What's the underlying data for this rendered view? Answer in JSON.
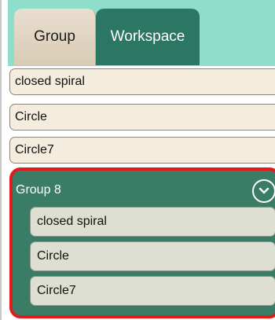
{
  "tabs": {
    "group_label": "Group",
    "workspace_label": "Workspace",
    "active": "Workspace"
  },
  "items": [
    {
      "label": "closed spiral"
    },
    {
      "label": "Circle"
    },
    {
      "label": "Circle7"
    }
  ],
  "group": {
    "label": "Group 8",
    "collapse_icon": "chevron-down-icon",
    "items": [
      {
        "label": "closed spiral"
      },
      {
        "label": "Circle"
      },
      {
        "label": "Circle7"
      }
    ]
  },
  "colors": {
    "tab_bar": "#8edec9",
    "active_tab": "#2b7764",
    "inactive_tab": "#e9dfcf",
    "item_bg": "#f4ecdc",
    "group_bg": "#3b7c66",
    "sub_item_bg": "#dcdfd1",
    "highlight_border": "#e41a1a"
  }
}
